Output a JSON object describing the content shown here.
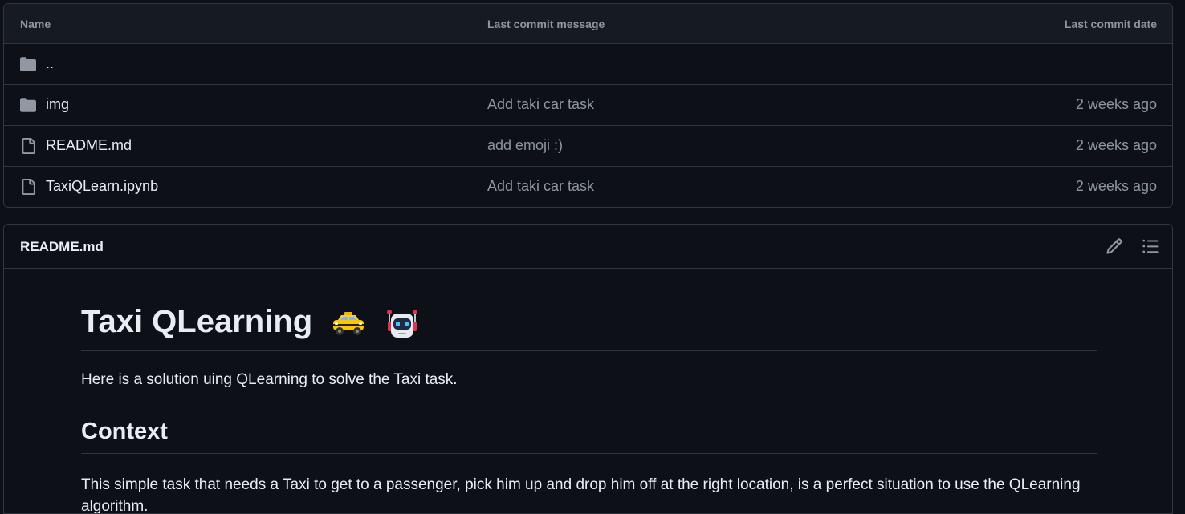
{
  "table": {
    "headers": {
      "name": "Name",
      "message": "Last commit message",
      "date": "Last commit date"
    },
    "rows": [
      {
        "icon": "folder-icon",
        "name": "..",
        "message": "",
        "date": ""
      },
      {
        "icon": "folder-icon",
        "name": "img",
        "message": "Add taki car task",
        "date": "2 weeks ago"
      },
      {
        "icon": "file-icon",
        "name": "README.md",
        "message": "add emoji :)",
        "date": "2 weeks ago"
      },
      {
        "icon": "file-icon",
        "name": "TaxiQLearn.ipynb",
        "message": "Add taki car task",
        "date": "2 weeks ago"
      }
    ]
  },
  "readme": {
    "filename": "README.md",
    "actions": {
      "edit_icon": "pencil-icon",
      "outline_icon": "list-unordered-icon"
    },
    "h1": "Taxi QLearning",
    "h1_emojis": [
      "taxi-emoji",
      "robot-emoji"
    ],
    "intro": "Here is a solution uing QLearning to solve the Taxi task.",
    "h2": "Context",
    "context_text": "This simple task that needs a Taxi to get to a passenger, pick him up and drop him off at the right location, is a perfect situation to use the QLearning algorithm."
  },
  "colors": {
    "background": "#0d1117",
    "header_background": "#161b22",
    "border": "#30363d",
    "text": "#e6edf3",
    "muted": "#8d96a0",
    "icon": "#9198a1"
  }
}
